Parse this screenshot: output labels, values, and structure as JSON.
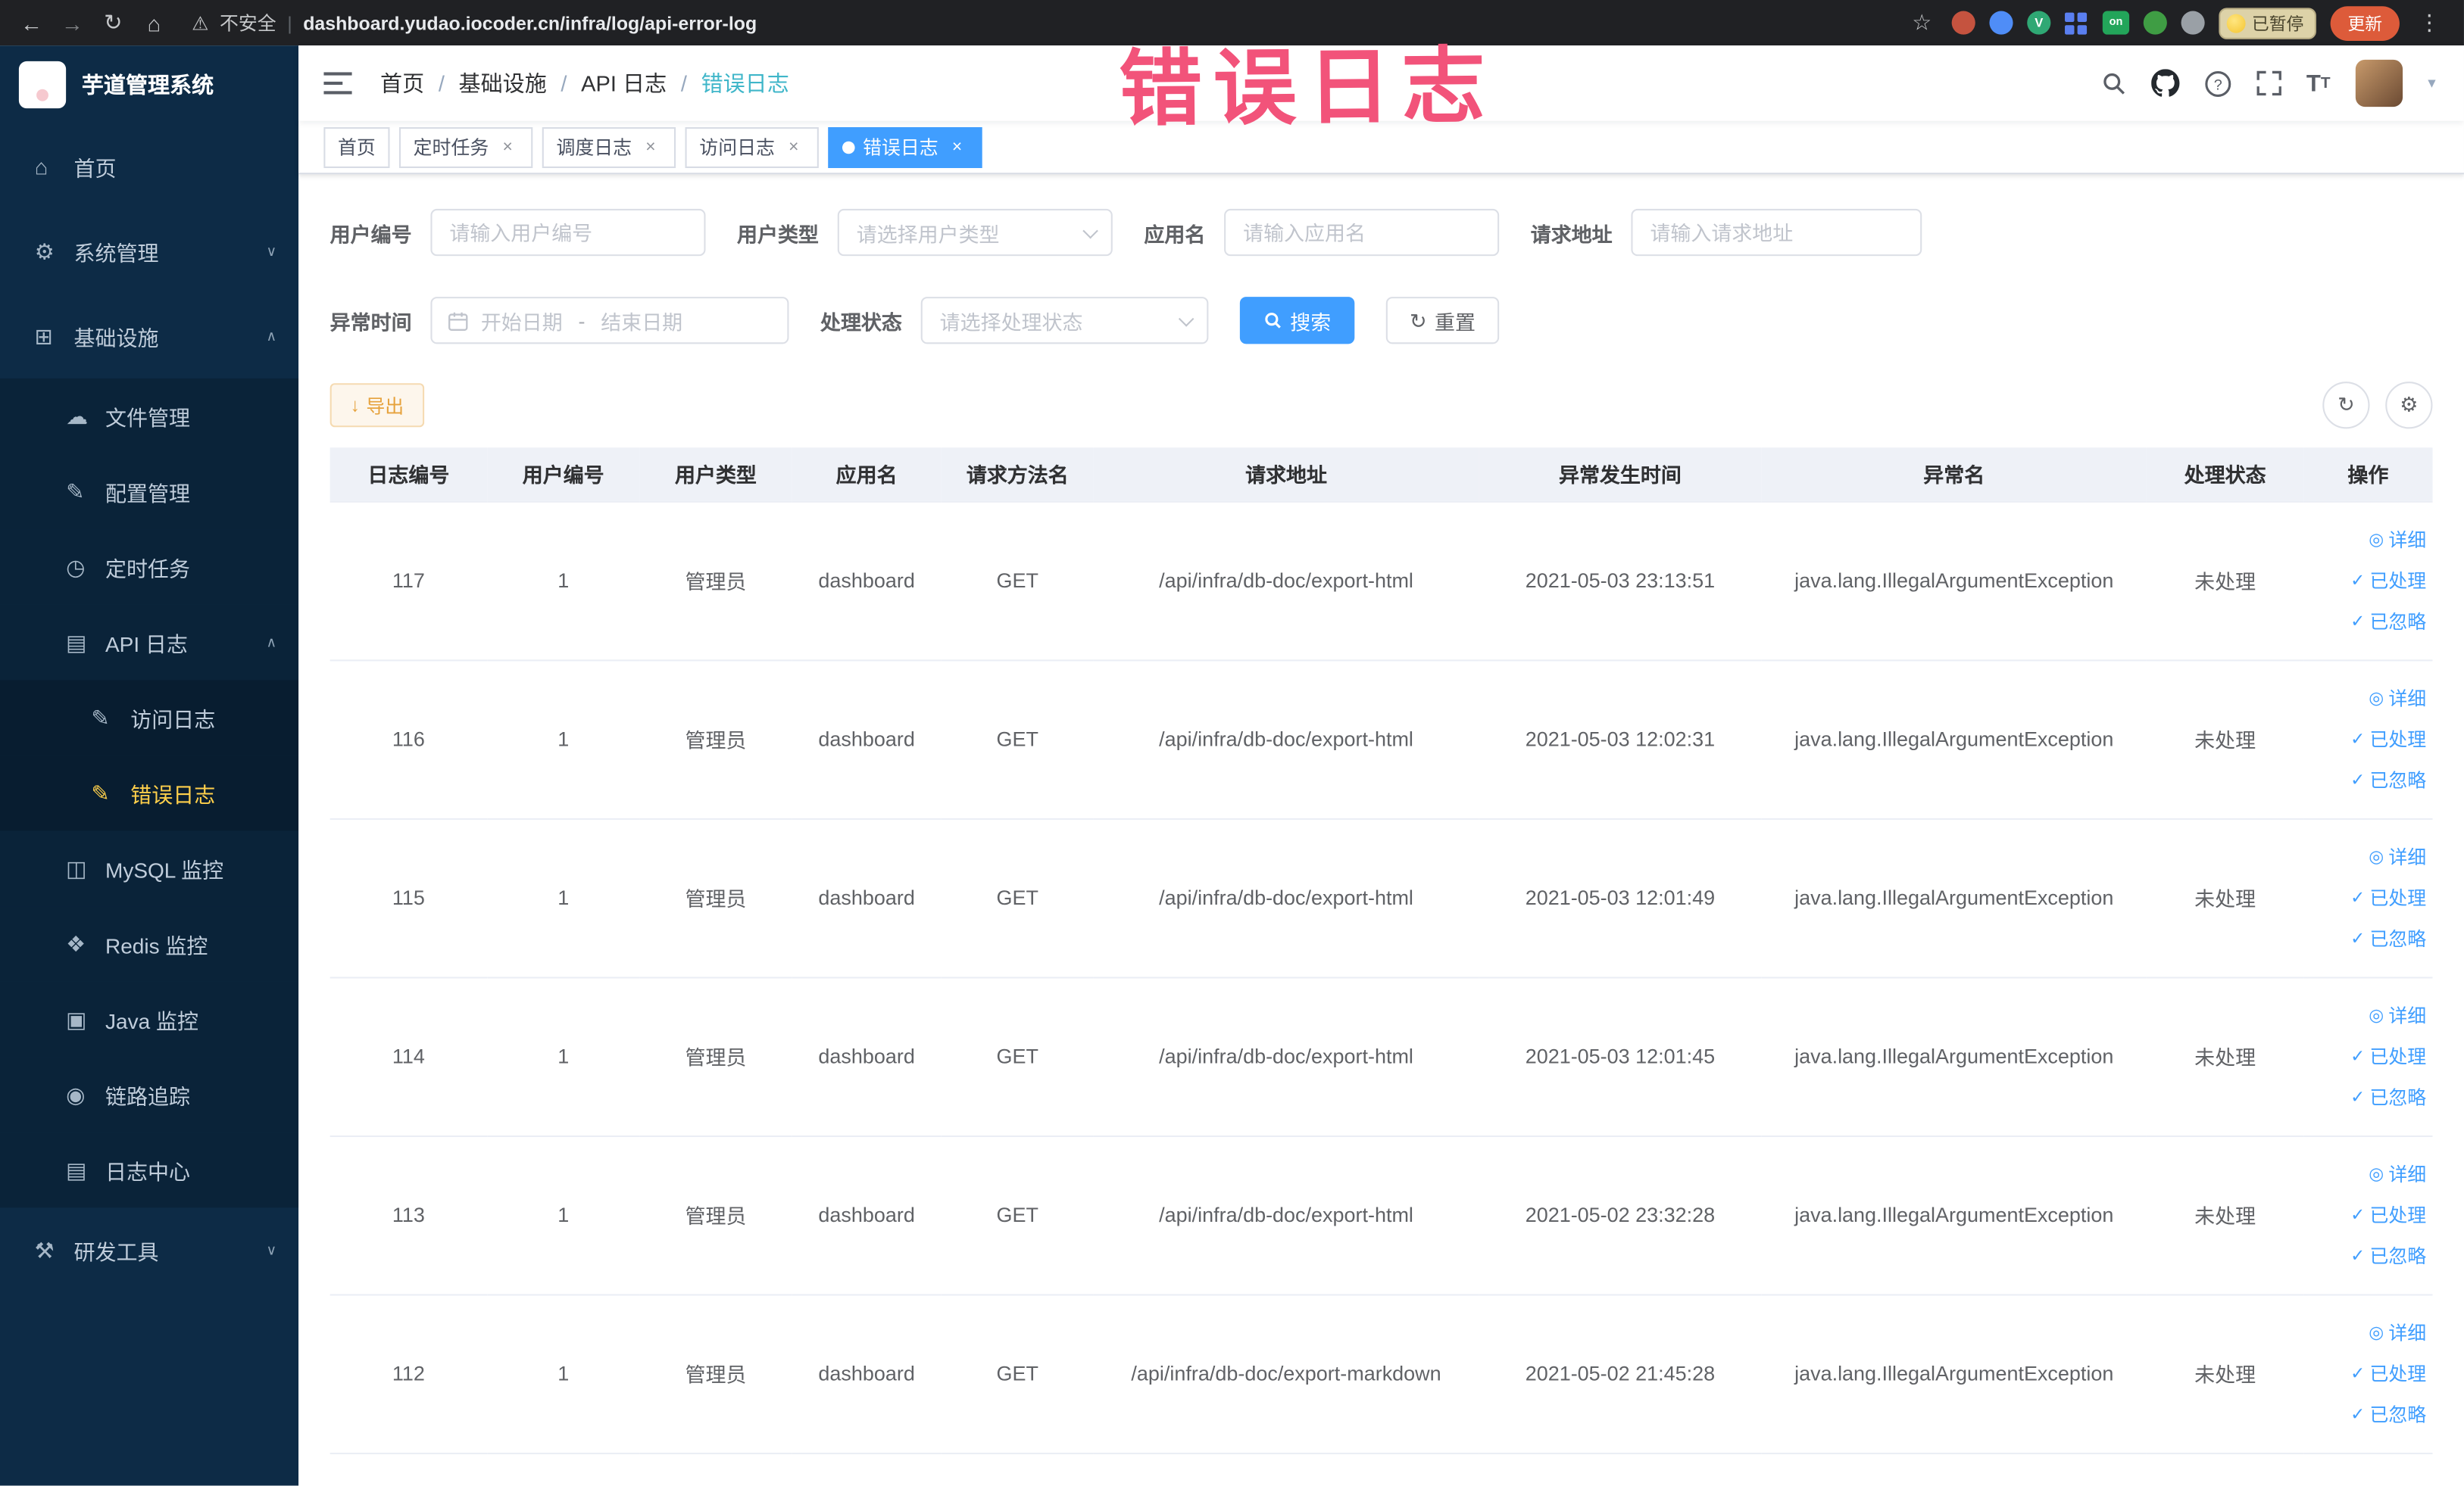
{
  "colors": {
    "accent_blue": "#409eff",
    "menu_active_yellow": "#ffd04b",
    "watermark_pink": "#f2537a",
    "warning_orange": "#e6a23c",
    "sidebar_bg": "#0d2b46"
  },
  "icons": {
    "back": "←",
    "forward": "→",
    "reload": "↻",
    "home": "⌂",
    "warning": "⚠",
    "star": "☆",
    "kebab": "⋮",
    "close": "×",
    "divider": "|",
    "menu_home": "⌂",
    "menu_gear": "⚙",
    "menu_infra": "⊞",
    "menu_cloud": "☁",
    "menu_edit": "✎",
    "menu_clock": "◷",
    "menu_apilog": "▤",
    "menu_doc": "✎",
    "menu_mysql": "◫",
    "menu_redis": "❖",
    "menu_java": "▣",
    "menu_trace": "◉",
    "menu_logcenter": "▤",
    "menu_tools": "⚒",
    "chev_down": "∨",
    "chev_up": "∧",
    "eye": "◎",
    "check": "✓",
    "download": "↓",
    "refresh": "↻",
    "gear": "⚙",
    "caret_down": "▾",
    "font_letter_big": "T",
    "font_letter_small": "T"
  },
  "browser": {
    "security_label": "不安全",
    "url": "dashboard.yudao.iocoder.cn/infra/log/api-error-log",
    "ext_v_label": "V",
    "ext_on_label": "on",
    "paused_label": "已暂停",
    "update_label": "更新"
  },
  "watermark": "错误日志",
  "sidebar": {
    "logo_title": "芋道管理系统",
    "items": [
      {
        "label": "首页"
      },
      {
        "label": "系统管理"
      },
      {
        "label": "基础设施"
      },
      {
        "label": "文件管理"
      },
      {
        "label": "配置管理"
      },
      {
        "label": "定时任务"
      },
      {
        "label": "API 日志"
      },
      {
        "label": "访问日志"
      },
      {
        "label": "错误日志"
      },
      {
        "label": "MySQL 监控"
      },
      {
        "label": "Redis 监控"
      },
      {
        "label": "Java 监控"
      },
      {
        "label": "链路追踪"
      },
      {
        "label": "日志中心"
      },
      {
        "label": "研发工具"
      }
    ]
  },
  "breadcrumb": {
    "separator": "/",
    "items": [
      "首页",
      "基础设施",
      "API 日志",
      "错误日志"
    ]
  },
  "tabs": [
    {
      "label": "首页"
    },
    {
      "label": "定时任务"
    },
    {
      "label": "调度日志"
    },
    {
      "label": "访问日志"
    },
    {
      "label": "错误日志"
    }
  ],
  "filters": {
    "user_id_label": "用户编号",
    "user_id_placeholder": "请输入用户编号",
    "user_type_label": "用户类型",
    "user_type_placeholder": "请选择用户类型",
    "app_name_label": "应用名",
    "app_name_placeholder": "请输入应用名",
    "request_url_label": "请求地址",
    "request_url_placeholder": "请输入请求地址",
    "exception_time_label": "异常时间",
    "start_placeholder": "开始日期",
    "range_separator": "-",
    "end_placeholder": "结束日期",
    "status_label": "处理状态",
    "status_placeholder": "请选择处理状态",
    "search_label": "搜索",
    "reset_label": "重置"
  },
  "toolbar": {
    "export_label": "导出"
  },
  "table": {
    "headers": [
      "日志编号",
      "用户编号",
      "用户类型",
      "应用名",
      "请求方法名",
      "请求地址",
      "异常发生时间",
      "异常名",
      "处理状态",
      "操作"
    ],
    "action_labels": [
      "详细",
      "已处理",
      "已忽略"
    ],
    "rows": [
      {
        "id": "117",
        "user_id": "1",
        "user_type": "管理员",
        "app": "dashboard",
        "method": "GET",
        "url": "/api/infra/db-doc/export-html",
        "time": "2021-05-03 23:13:51",
        "exception": "java.lang.IllegalArgumentException",
        "status": "未处理"
      },
      {
        "id": "116",
        "user_id": "1",
        "user_type": "管理员",
        "app": "dashboard",
        "method": "GET",
        "url": "/api/infra/db-doc/export-html",
        "time": "2021-05-03 12:02:31",
        "exception": "java.lang.IllegalArgumentException",
        "status": "未处理"
      },
      {
        "id": "115",
        "user_id": "1",
        "user_type": "管理员",
        "app": "dashboard",
        "method": "GET",
        "url": "/api/infra/db-doc/export-html",
        "time": "2021-05-03 12:01:49",
        "exception": "java.lang.IllegalArgumentException",
        "status": "未处理"
      },
      {
        "id": "114",
        "user_id": "1",
        "user_type": "管理员",
        "app": "dashboard",
        "method": "GET",
        "url": "/api/infra/db-doc/export-html",
        "time": "2021-05-03 12:01:45",
        "exception": "java.lang.IllegalArgumentException",
        "status": "未处理"
      },
      {
        "id": "113",
        "user_id": "1",
        "user_type": "管理员",
        "app": "dashboard",
        "method": "GET",
        "url": "/api/infra/db-doc/export-html",
        "time": "2021-05-02 23:32:28",
        "exception": "java.lang.IllegalArgumentException",
        "status": "未处理"
      },
      {
        "id": "112",
        "user_id": "1",
        "user_type": "管理员",
        "app": "dashboard",
        "method": "GET",
        "url": "/api/infra/db-doc/export-markdown",
        "time": "2021-05-02 21:45:28",
        "exception": "java.lang.IllegalArgumentException",
        "status": "未处理"
      }
    ]
  }
}
